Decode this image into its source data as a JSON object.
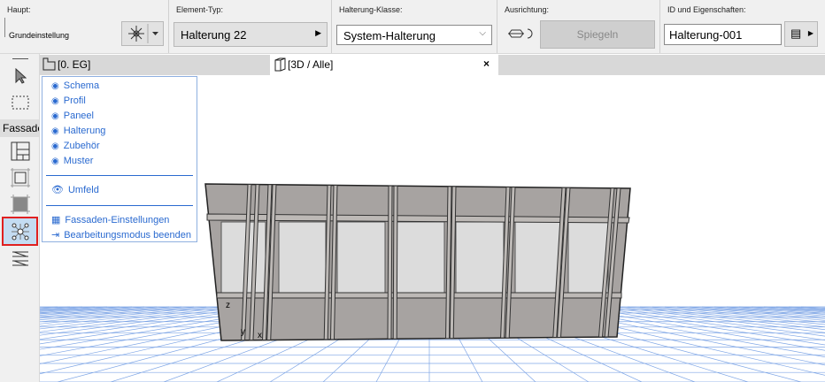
{
  "toolbar": {
    "main": {
      "label": "Haupt:",
      "value": "Grundeinstellung"
    },
    "element_type": {
      "label": "Element-Typ:",
      "value": "Halterung 22"
    },
    "class": {
      "label": "Halterung-Klasse:",
      "value": "System-Halterung"
    },
    "orientation": {
      "label": "Ausrichtung:",
      "mirror_label": "Spiegeln"
    },
    "id": {
      "label": "ID und Eigenschaften:",
      "value": "Halterung-001"
    }
  },
  "tabs": [
    {
      "label": "[0. EG]"
    },
    {
      "label": "[3D / Alle]",
      "close": "×"
    }
  ],
  "sidebar": {
    "section_label": "Fassade"
  },
  "menu": {
    "items": [
      {
        "label": "Schema"
      },
      {
        "label": "Profil"
      },
      {
        "label": "Paneel"
      },
      {
        "label": "Halterung"
      },
      {
        "label": "Zubehör"
      },
      {
        "label": "Muster"
      }
    ],
    "umfeld": "Umfeld",
    "settings": "Fassaden-Einstellungen",
    "exit": "Bearbeitungsmodus beenden"
  },
  "axes": {
    "z": "z",
    "y": "y",
    "x": "x"
  },
  "colors": {
    "accent": "#2a6ad0",
    "highlight": "#e02020",
    "selected_bg": "#c4dcf2"
  }
}
